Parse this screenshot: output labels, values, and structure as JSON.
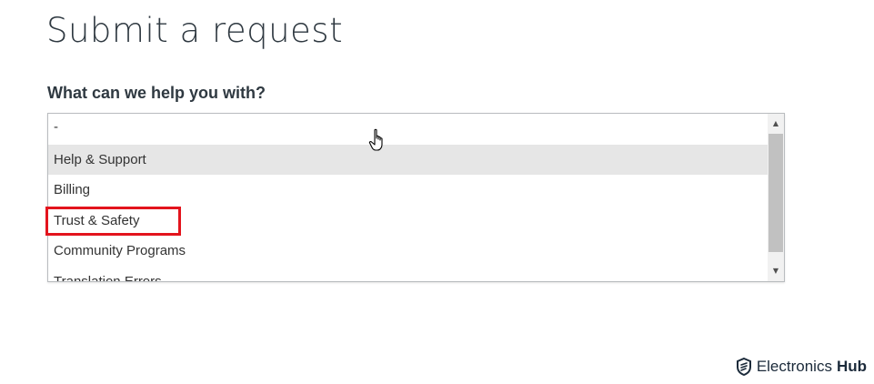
{
  "page": {
    "title": "Submit a request"
  },
  "form": {
    "question_label": "What can we help you with?",
    "options": [
      "-",
      "Help & Support",
      "Billing",
      "Trust & Safety",
      "Community Programs",
      "Translation Errors"
    ],
    "hovered_option": "Help & Support",
    "annotated_option": "Trust & Safety"
  },
  "watermark": {
    "brand_first": "Electronics",
    "brand_second": "Hub"
  },
  "colors": {
    "title_text": "#2f3941",
    "hover_background": "#e6e6e6",
    "annotation_border": "#e3141d"
  },
  "icons": {
    "cursor": "hand-pointer-icon",
    "logo": "shield-logo-icon",
    "scroll_up": "triangle-up-icon",
    "scroll_down": "triangle-down-icon"
  }
}
